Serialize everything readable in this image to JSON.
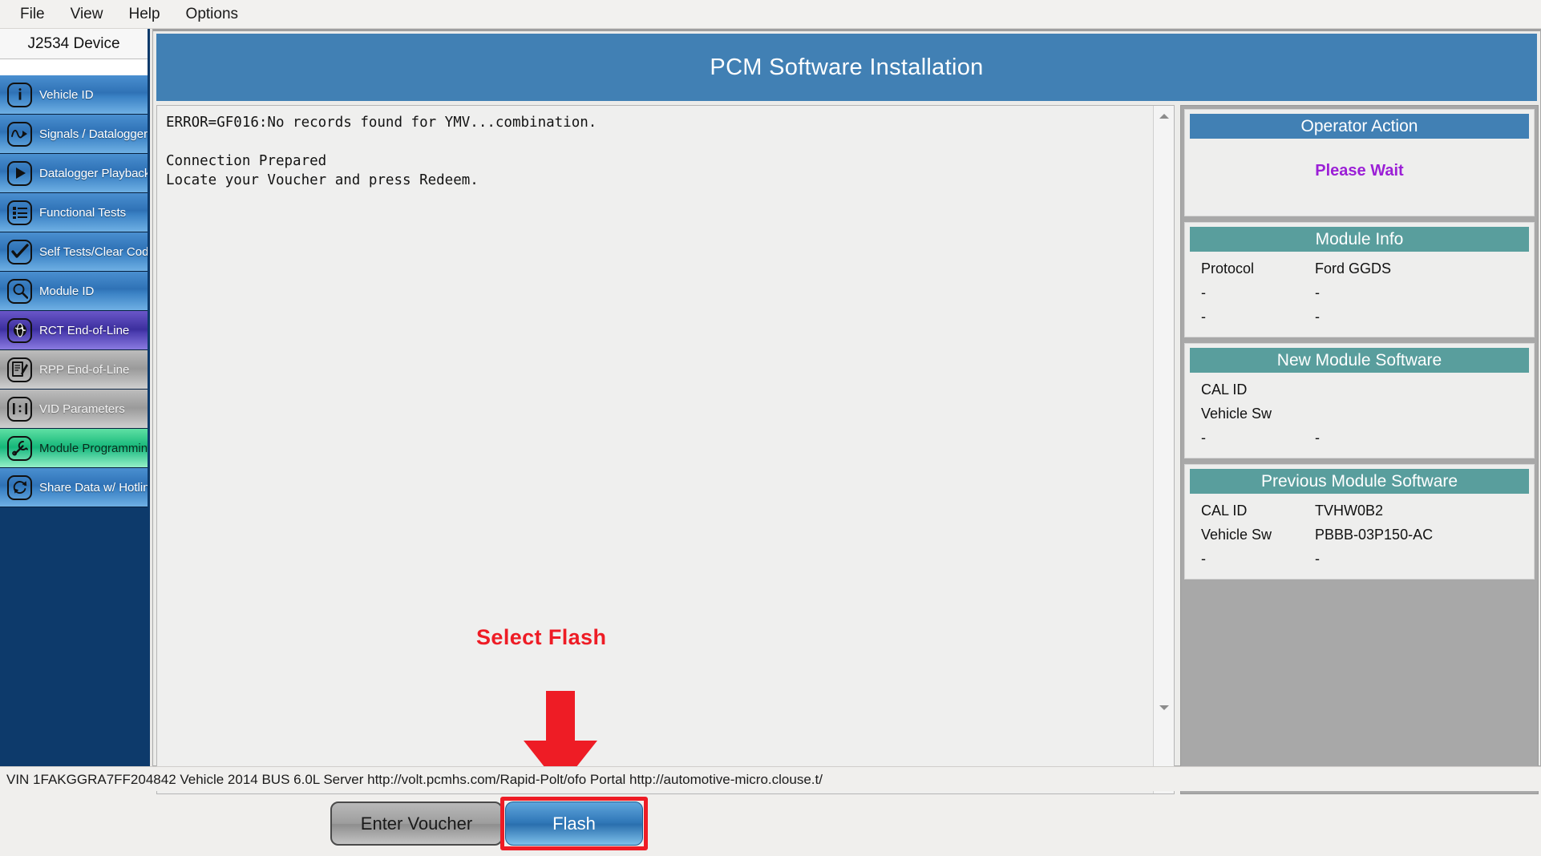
{
  "menubar": {
    "items": [
      "File",
      "View",
      "Help",
      "Options"
    ]
  },
  "sidebar": {
    "header": "J2534 Device",
    "items": [
      {
        "label": "Vehicle ID",
        "icon": "info-icon",
        "state": "blue"
      },
      {
        "label": "Signals / Datalogger",
        "icon": "waveform-icon",
        "state": "blue"
      },
      {
        "label": "Datalogger Playback",
        "icon": "play-icon",
        "state": "blue"
      },
      {
        "label": "Functional Tests",
        "icon": "list-icon",
        "state": "blue"
      },
      {
        "label": "Self Tests/Clear Codes",
        "icon": "checkmark-icon",
        "state": "blue"
      },
      {
        "label": "Module ID",
        "icon": "magnifier-icon",
        "state": "blue"
      },
      {
        "label": "RCT End-of-Line",
        "icon": "globe-icon",
        "state": "purple"
      },
      {
        "label": "RPP End-of-Line",
        "icon": "clipboard-pencil-icon",
        "state": "gray"
      },
      {
        "label": "VID Parameters",
        "icon": "ratio-icon",
        "state": "gray"
      },
      {
        "label": "Module Programming",
        "icon": "wrench-icon",
        "state": "green"
      },
      {
        "label": "Share Data w/ Hotline",
        "icon": "sync-icon",
        "state": "blue"
      }
    ]
  },
  "main": {
    "title": "PCM Software Installation",
    "log": "ERROR=GF016:No records found for YMV...combination.\n\nConnection Prepared\nLocate your Voucher and press Redeem.",
    "annotation": "Select Flash",
    "buttons": {
      "enter_voucher": "Enter Voucher",
      "flash": "Flash"
    }
  },
  "right": {
    "operator_action": {
      "title": "Operator Action",
      "status": "Please Wait"
    },
    "module_info": {
      "title": "Module Info",
      "rows": [
        {
          "key": "Protocol",
          "value": "Ford GGDS"
        },
        {
          "key": "-",
          "value": "-"
        },
        {
          "key": "-",
          "value": "-"
        }
      ]
    },
    "new_module_software": {
      "title": "New Module Software",
      "rows": [
        {
          "key": "CAL ID",
          "value": ""
        },
        {
          "key": "Vehicle Sw",
          "value": ""
        },
        {
          "key": "-",
          "value": "-"
        }
      ]
    },
    "previous_module_software": {
      "title": "Previous Module Software",
      "rows": [
        {
          "key": "CAL ID",
          "value": "TVHW0B2"
        },
        {
          "key": "Vehicle Sw",
          "value": "PBBB-03P150-AC"
        },
        {
          "key": "-",
          "value": "-"
        }
      ]
    }
  },
  "statusbar": {
    "text": "VIN 1FAKGGRA7FF204842  Vehicle 2014 BUS 6.0L  Server http://volt.pcmhs.com/Rapid-Polt/ofo  Portal http://automotive-micro.clouse.t/"
  },
  "colors": {
    "accent_blue": "#4180b4",
    "teal": "#599e9d",
    "sidebar_navy": "#0d3a6b",
    "annotation_red": "#ee1c25",
    "status_purple": "#9b1fd6",
    "green": "#15b779"
  }
}
